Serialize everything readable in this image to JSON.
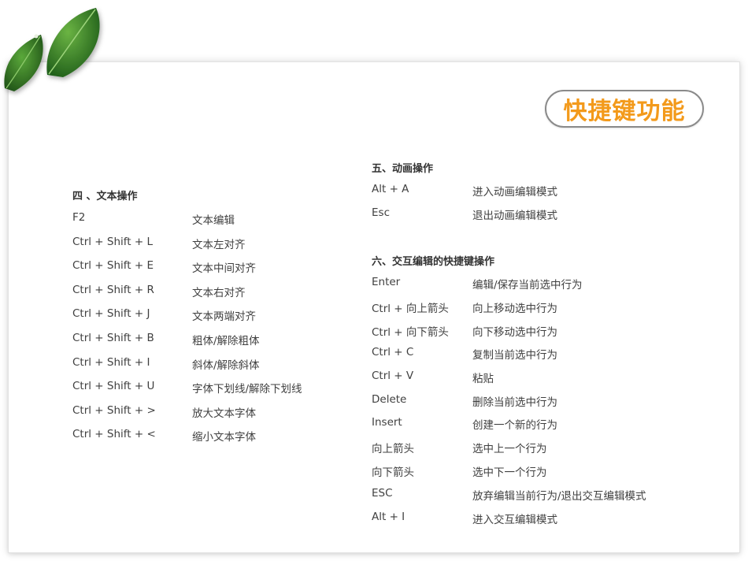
{
  "title": "快捷键功能",
  "text_section": {
    "title": "四 、文本操作",
    "rows": [
      {
        "key": "F2",
        "desc": "文本编辑"
      },
      {
        "key": "Ctrl + Shift + L",
        "desc": "文本左对齐"
      },
      {
        "key": "Ctrl + Shift + E",
        "desc": "文本中间对齐"
      },
      {
        "key": "Ctrl + Shift + R",
        "desc": "文本右对齐"
      },
      {
        "key": "Ctrl + Shift + J",
        "desc": "文本两端对齐"
      },
      {
        "key": "Ctrl + Shift + B",
        "desc": "粗体/解除粗体"
      },
      {
        "key": "Ctrl + Shift + I",
        "desc": "斜体/解除斜体"
      },
      {
        "key": "Ctrl + Shift + U",
        "desc": "字体下划线/解除下划线"
      },
      {
        "key": "Ctrl + Shift + >",
        "desc": "放大文本字体"
      },
      {
        "key": "Ctrl + Shift + <",
        "desc": "缩小文本字体"
      }
    ]
  },
  "animation_section": {
    "title": "五、动画操作",
    "rows": [
      {
        "key": "Alt + A",
        "desc": "进入动画编辑模式"
      },
      {
        "key": "Esc",
        "desc": "退出动画编辑模式"
      }
    ]
  },
  "interaction_section": {
    "title": "六、交互编辑的快捷键操作",
    "rows": [
      {
        "key": "Enter",
        "desc": "编辑/保存当前选中行为"
      },
      {
        "key": "Ctrl + 向上箭头",
        "desc": "向上移动选中行为"
      },
      {
        "key": "Ctrl + 向下箭头",
        "desc": "向下移动选中行为"
      },
      {
        "key": "Ctrl + C",
        "desc": "复制当前选中行为"
      },
      {
        "key": "Ctrl + V",
        "desc": "粘贴"
      },
      {
        "key": "Delete",
        "desc": "删除当前选中行为"
      },
      {
        "key": "Insert",
        "desc": "创建一个新的行为"
      },
      {
        "key": "向上箭头",
        "desc": "选中上一个行为"
      },
      {
        "key": "向下箭头",
        "desc": "选中下一个行为"
      },
      {
        "key": "ESC",
        "desc": "放弃编辑当前行为/退出交互编辑模式"
      },
      {
        "key": "Alt + I",
        "desc": "进入交互编辑模式"
      }
    ]
  },
  "colors": {
    "accent": "#f39a1b",
    "leaf": "#3f8a2c",
    "text": "#404040"
  }
}
